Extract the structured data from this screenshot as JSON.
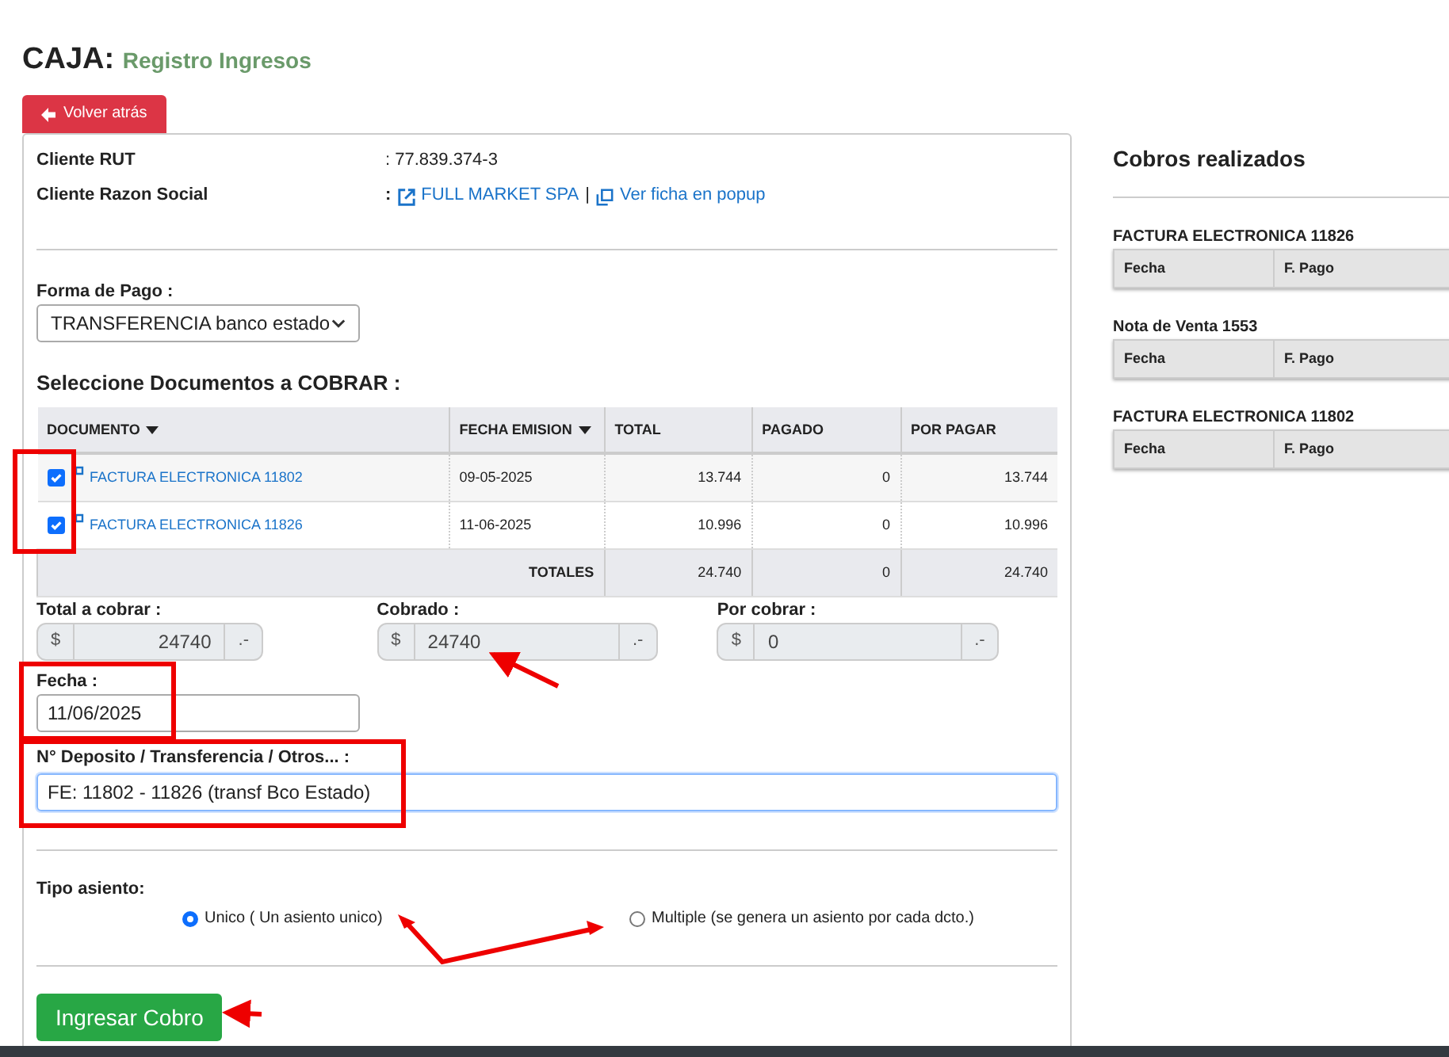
{
  "title": {
    "main": "CAJA:",
    "sub": "Registro Ingresos"
  },
  "back_button": {
    "label": "Volver atrás"
  },
  "client": [
    {
      "label": "Cliente RUT",
      "value": ": 77.839.374-3"
    },
    {
      "label": "Cliente Razon Social",
      "prefix": ":",
      "link": "FULL MARKET SPA",
      "separator": "|",
      "popup_link": "Ver ficha en popup"
    }
  ],
  "payment_method": {
    "label": "Forma de Pago :",
    "value": "TRANSFERENCIA banco estado"
  },
  "documents_heading": "Seleccione Documentos a COBRAR :",
  "table": {
    "columns": [
      {
        "label": "DOCUMENTO",
        "sortable": true
      },
      {
        "label": "FECHA EMISION",
        "sortable": true
      },
      {
        "label": "TOTAL",
        "sortable": false
      },
      {
        "label": "PAGADO",
        "sortable": false
      },
      {
        "label": "POR PAGAR",
        "sortable": false
      }
    ],
    "rows": [
      {
        "checked": true,
        "document": "FACTURA ELECTRONICA 11802",
        "date": "09-05-2025",
        "total": "13.744",
        "paid": "0",
        "due": "13.744"
      },
      {
        "checked": true,
        "document": "FACTURA ELECTRONICA 11826",
        "date": "11-06-2025",
        "total": "10.996",
        "paid": "0",
        "due": "10.996"
      }
    ],
    "totals": {
      "label": "TOTALES",
      "total": "24.740",
      "paid": "0",
      "due": "24.740"
    }
  },
  "amounts": [
    {
      "label": "Total a cobrar :",
      "prefix": "$",
      "value": "24740",
      "suffix": ".-"
    },
    {
      "label": "Cobrado :",
      "prefix": "$",
      "value": "24740",
      "suffix": ".-"
    },
    {
      "label": "Por cobrar :",
      "prefix": "$",
      "value": "0",
      "suffix": ".-"
    }
  ],
  "date_field": {
    "label": "Fecha :",
    "value": "11/06/2025"
  },
  "reference_field": {
    "label": "N° Deposito / Transferencia / Otros... :",
    "value": "FE: 11802 - 11826 (transf Bco Estado)",
    "focused": true
  },
  "entry_type": {
    "label": "Tipo asiento:",
    "options": [
      {
        "label": "Unico ( Un asiento unico)",
        "selected": true
      },
      {
        "label": "Multiple (se genera un asiento por cada dcto.)",
        "selected": false
      }
    ]
  },
  "submit_button": {
    "label": "Ingresar Cobro"
  },
  "payments": {
    "heading": "Cobros realizados",
    "groups": [
      {
        "title": "FACTURA ELECTRONICA 11826",
        "columns": [
          "Fecha",
          "F. Pago"
        ]
      },
      {
        "title": "Nota de Venta 1553",
        "columns": [
          "Fecha",
          "F. Pago"
        ]
      },
      {
        "title": "FACTURA ELECTRONICA 11802",
        "columns": [
          "Fecha",
          "F. Pago"
        ]
      }
    ]
  }
}
